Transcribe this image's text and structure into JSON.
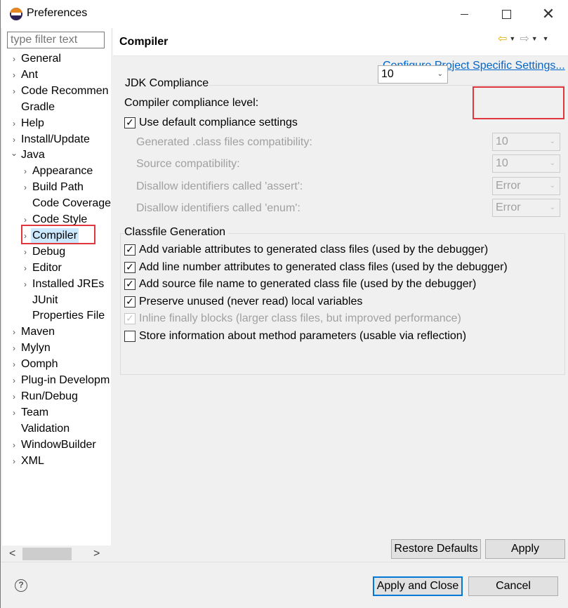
{
  "window": {
    "title": "Preferences",
    "minimize_label": "",
    "maximize_label": "",
    "close_glyph": "✕"
  },
  "left": {
    "filter_placeholder": "type filter text",
    "tree": [
      {
        "label": "General",
        "arrow": "›",
        "level": 0
      },
      {
        "label": "Ant",
        "arrow": "›",
        "level": 0
      },
      {
        "label": "Code Recommen",
        "arrow": "›",
        "level": 0
      },
      {
        "label": "Gradle",
        "arrow": "",
        "level": 0
      },
      {
        "label": "Help",
        "arrow": "›",
        "level": 0
      },
      {
        "label": "Install/Update",
        "arrow": "›",
        "level": 0
      },
      {
        "label": "Java",
        "arrow": "⌄",
        "level": 0
      },
      {
        "label": "Appearance",
        "arrow": "›",
        "level": 1
      },
      {
        "label": "Build Path",
        "arrow": "›",
        "level": 1
      },
      {
        "label": "Code Coverage",
        "arrow": "",
        "level": 1
      },
      {
        "label": "Code Style",
        "arrow": "›",
        "level": 1
      },
      {
        "label": "Compiler",
        "arrow": "›",
        "level": 1,
        "selected": true
      },
      {
        "label": "Debug",
        "arrow": "›",
        "level": 1
      },
      {
        "label": "Editor",
        "arrow": "›",
        "level": 1
      },
      {
        "label": "Installed JREs",
        "arrow": "›",
        "level": 1
      },
      {
        "label": "JUnit",
        "arrow": "",
        "level": 1
      },
      {
        "label": "Properties File",
        "arrow": "",
        "level": 1
      },
      {
        "label": "Maven",
        "arrow": "›",
        "level": 0
      },
      {
        "label": "Mylyn",
        "arrow": "›",
        "level": 0
      },
      {
        "label": "Oomph",
        "arrow": "›",
        "level": 0
      },
      {
        "label": "Plug-in Developm",
        "arrow": "›",
        "level": 0
      },
      {
        "label": "Run/Debug",
        "arrow": "›",
        "level": 0
      },
      {
        "label": "Team",
        "arrow": "›",
        "level": 0
      },
      {
        "label": "Validation",
        "arrow": "",
        "level": 0
      },
      {
        "label": "WindowBuilder",
        "arrow": "›",
        "level": 0
      },
      {
        "label": "XML",
        "arrow": "›",
        "level": 0
      }
    ],
    "scroll_left": "<",
    "scroll_right": ">"
  },
  "page": {
    "title": "Compiler",
    "config_link": "Configure Project Specific Settings...",
    "nav_back": "⇦",
    "nav_forward": "⇨",
    "nav_dropdown": "▼"
  },
  "jdk": {
    "group_title": "JDK Compliance",
    "compliance_label": "Compiler compliance level:",
    "compliance_value": "10",
    "use_default_label": "Use default compliance settings",
    "use_default_checked": true,
    "generated_label": "Generated .class files compatibility:",
    "generated_value": "10",
    "source_label": "Source compatibility:",
    "source_value": "10",
    "assert_label": "Disallow identifiers called 'assert':",
    "assert_value": "Error",
    "enum_label": "Disallow identifiers called 'enum':",
    "enum_value": "Error"
  },
  "classfile": {
    "group_title": "Classfile Generation",
    "options": [
      {
        "label": "Add variable attributes to generated class files (used by the debugger)",
        "checked": true,
        "disabled": false
      },
      {
        "label": "Add line number attributes to generated class files (used by the debugger)",
        "checked": true,
        "disabled": false
      },
      {
        "label": "Add source file name to generated class file (used by the debugger)",
        "checked": true,
        "disabled": false
      },
      {
        "label": "Preserve unused (never read) local variables",
        "checked": true,
        "disabled": false
      },
      {
        "label": "Inline finally blocks (larger class files, but improved performance)",
        "checked": true,
        "disabled": true
      },
      {
        "label": "Store information about method parameters (usable via reflection)",
        "checked": false,
        "disabled": false
      }
    ]
  },
  "buttons": {
    "restore_defaults": "Restore Defaults",
    "apply": "Apply",
    "apply_and_close": "Apply and Close",
    "cancel": "Cancel",
    "help": "?"
  },
  "colors": {
    "highlight_red": "#e0363e",
    "link_blue": "#0066cc",
    "selection_blue": "#cce8ff",
    "default_button_border": "#0078d7"
  }
}
